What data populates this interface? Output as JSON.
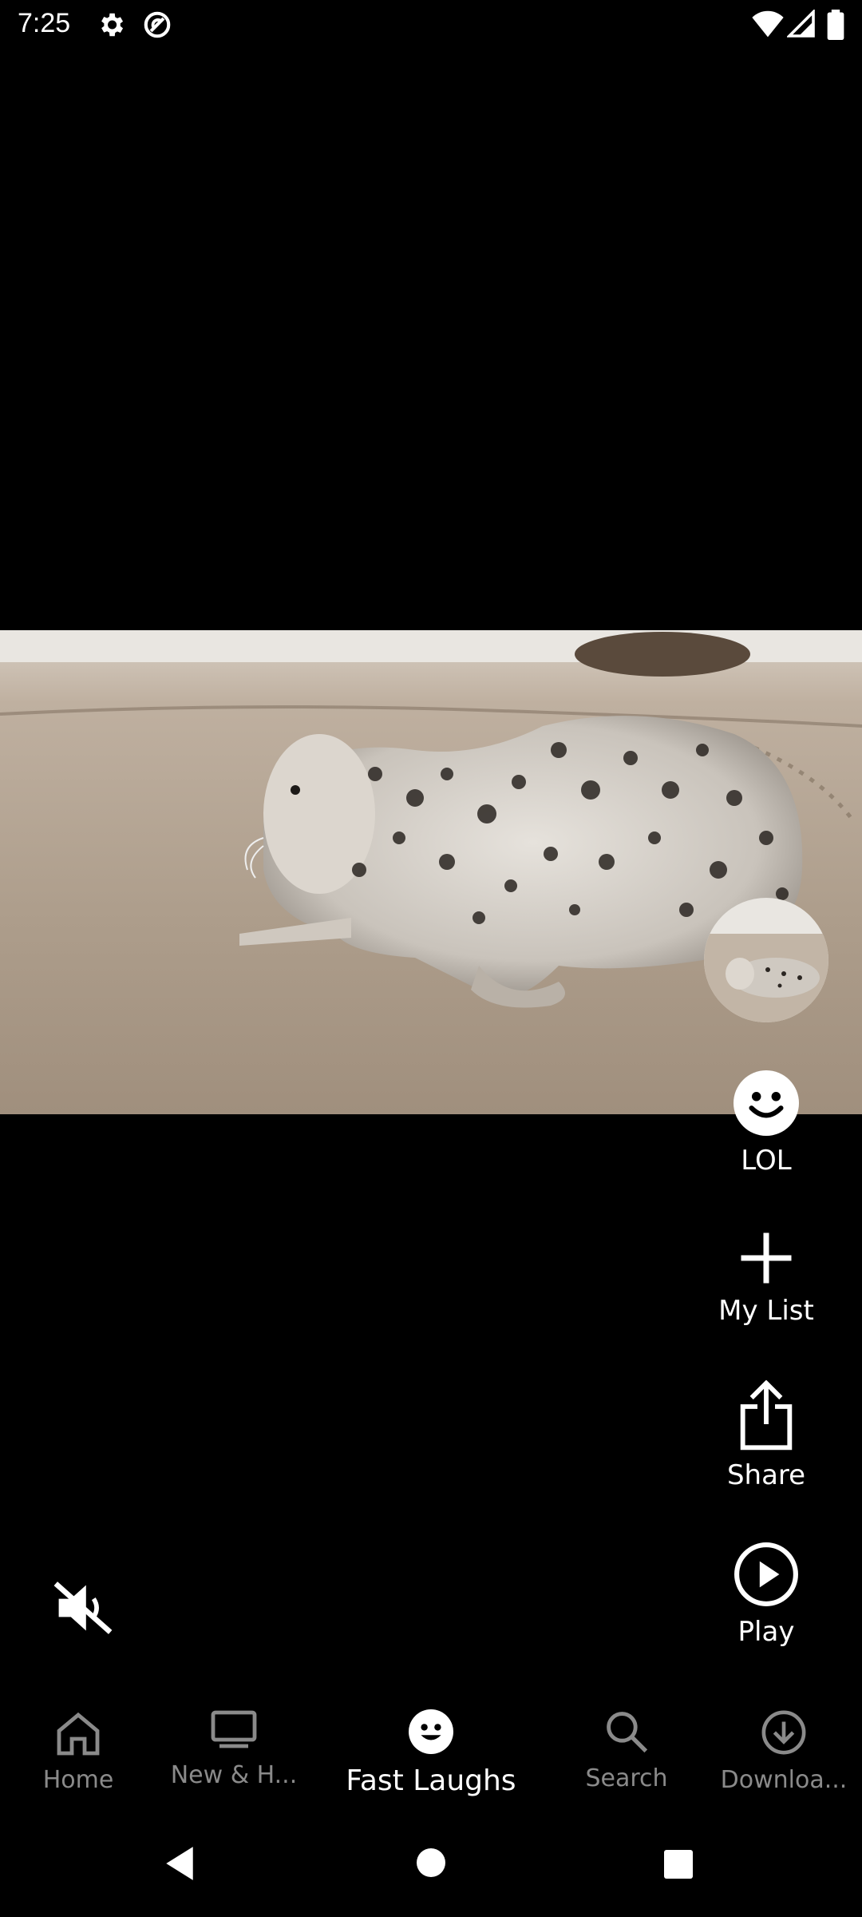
{
  "status": {
    "time": "7:25",
    "icons": [
      "gear-icon",
      "vpn-icon",
      "wifi-icon",
      "signal-icon",
      "battery-icon"
    ]
  },
  "video": {
    "subject": "harbor seal pup on a beach",
    "muted": true
  },
  "actions": {
    "lol_label": "LOL",
    "mylist_label": "My List",
    "share_label": "Share",
    "play_label": "Play"
  },
  "bottom_nav": {
    "items": [
      {
        "label": "Home",
        "icon": "home-icon",
        "active": false
      },
      {
        "label": "New & H...",
        "icon": "tv-icon",
        "active": false
      },
      {
        "label": "Fast Laughs",
        "icon": "smiley-icon",
        "active": true
      },
      {
        "label": "Search",
        "icon": "search-icon",
        "active": false
      },
      {
        "label": "Downloa...",
        "icon": "download-icon",
        "active": false
      }
    ]
  },
  "colors": {
    "background": "#000000",
    "active_label": "#ffffff",
    "inactive_label": "#8a8a8a"
  }
}
